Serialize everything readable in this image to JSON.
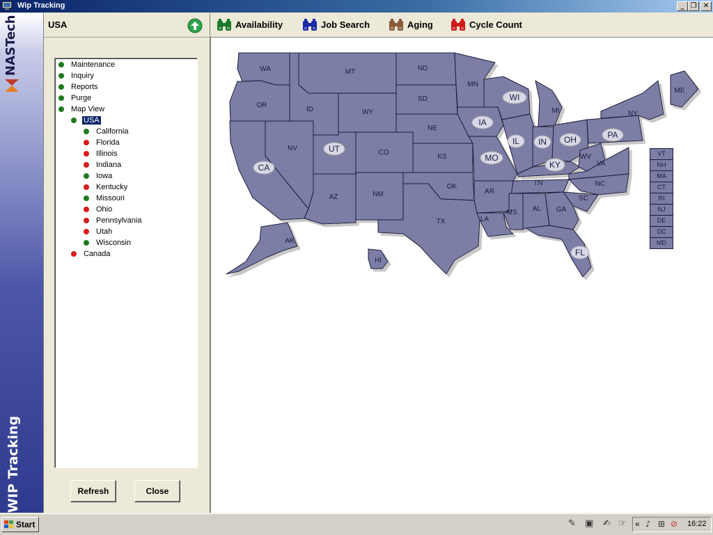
{
  "window": {
    "title": "Wip Tracking",
    "min": "_",
    "max": "❒",
    "close": "✕"
  },
  "sidebar": {
    "brand": "NASTech",
    "caption": "WIP Tracking"
  },
  "panel": {
    "title": "USA",
    "tree": [
      {
        "label": "Maintenance",
        "status": "green",
        "level": 0
      },
      {
        "label": "Inquiry",
        "status": "green",
        "level": 0
      },
      {
        "label": "Reports",
        "status": "green",
        "level": 0
      },
      {
        "label": "Purge",
        "status": "green",
        "level": 0
      },
      {
        "label": "Map View",
        "status": "green",
        "level": 0
      },
      {
        "label": "USA",
        "status": "green",
        "level": 1,
        "selected": true
      },
      {
        "label": "California",
        "status": "green",
        "level": 2
      },
      {
        "label": "Florida",
        "status": "red",
        "level": 2
      },
      {
        "label": "Illinois",
        "status": "red",
        "level": 2
      },
      {
        "label": "Indiana",
        "status": "red",
        "level": 2
      },
      {
        "label": "Iowa",
        "status": "green",
        "level": 2
      },
      {
        "label": "Kentucky",
        "status": "red",
        "level": 2
      },
      {
        "label": "Missouri",
        "status": "green",
        "level": 2
      },
      {
        "label": "Ohio",
        "status": "red",
        "level": 2
      },
      {
        "label": "Pennsylvania",
        "status": "red",
        "level": 2
      },
      {
        "label": "Utah",
        "status": "red",
        "level": 2
      },
      {
        "label": "Wisconsin",
        "status": "green",
        "level": 2
      },
      {
        "label": "Canada",
        "status": "red",
        "level": 1
      }
    ],
    "refresh_label": "Refresh",
    "close_label": "Close",
    "collapse_glyph": "‹‹‹"
  },
  "toolbar": [
    {
      "label": "Availability",
      "icon": "binoculars-icon",
      "color": "#1b7a2a"
    },
    {
      "label": "Job Search",
      "icon": "binoculars-icon",
      "color": "#1a2aa8"
    },
    {
      "label": "Aging",
      "icon": "binoculars-icon",
      "color": "#8a5a3a"
    },
    {
      "label": "Cycle Count",
      "icon": "binoculars-icon",
      "color": "#d01a1a"
    }
  ],
  "map": {
    "states": [
      "WA",
      "MT",
      "ND",
      "MN",
      "OR",
      "ID",
      "WY",
      "SD",
      "NE",
      "IA",
      "WI",
      "MI",
      "NY",
      "ME",
      "NV",
      "UT",
      "CO",
      "KS",
      "MO",
      "IL",
      "IN",
      "OH",
      "PA",
      "CA",
      "AZ",
      "NM",
      "OK",
      "AR",
      "TN",
      "KY",
      "WV",
      "VA",
      "NC",
      "SC",
      "TX",
      "LA",
      "MS",
      "AL",
      "GA",
      "FL",
      "AK",
      "HI"
    ],
    "highlighted": [
      "CA",
      "UT",
      "IA",
      "WI",
      "IL",
      "IN",
      "OH",
      "PA",
      "MO",
      "KY",
      "FL"
    ],
    "small_states": [
      "VT",
      "NH",
      "MA",
      "CT",
      "RI",
      "NJ",
      "DE",
      "DC",
      "MD"
    ]
  },
  "taskbar": {
    "start_label": "Start",
    "clock": "16:22",
    "tray_chevron": "«"
  },
  "colors": {
    "state_fill": "#7c7ea6",
    "status_green": "#1f7a1f",
    "status_red": "#d91a1a",
    "title_bar": "#0a246a"
  }
}
